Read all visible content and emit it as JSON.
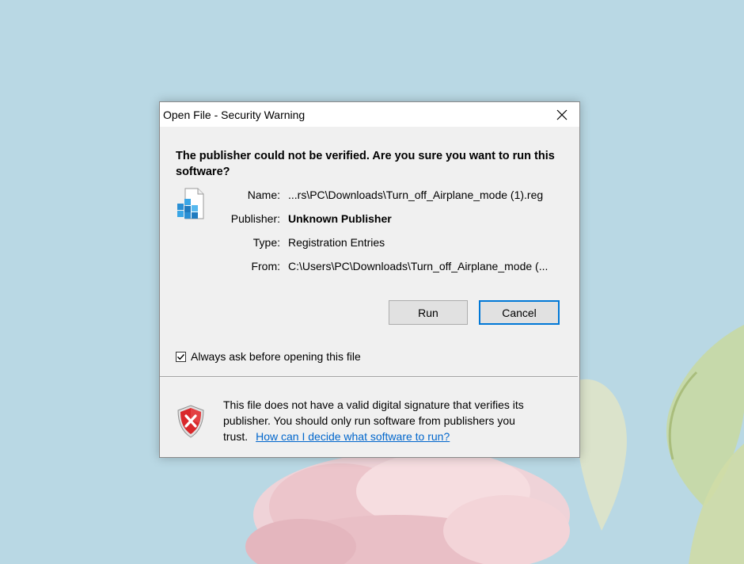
{
  "dialog": {
    "title": "Open File - Security Warning",
    "headline": "The publisher could not be verified.  Are you sure you want to run this software?",
    "fields": [
      {
        "label": "Name:",
        "value": "...rs\\PC\\Downloads\\Turn_off_Airplane_mode (1).reg"
      },
      {
        "label": "Publisher:",
        "value": "Unknown Publisher"
      },
      {
        "label": "Type:",
        "value": "Registration Entries"
      },
      {
        "label": "From:",
        "value": "C:\\Users\\PC\\Downloads\\Turn_off_Airplane_mode (..."
      }
    ],
    "run_label": "Run",
    "cancel_label": "Cancel",
    "checkbox_label": "Always ask before opening this file",
    "checkbox_checked": true,
    "warning_text": "This file does not have a valid digital signature that verifies its publisher.  You should only run software from publishers you trust.",
    "help_link": "How can I decide what software to run?"
  },
  "colors": {
    "desktop": "#b9d8e4",
    "accent": "#0078d7",
    "link": "#0066cc",
    "shield_red": "#d9282b"
  },
  "icons": {
    "file": "registry-file-icon",
    "warning": "security-shield-icon",
    "close": "close-icon",
    "check": "checkmark-icon"
  }
}
